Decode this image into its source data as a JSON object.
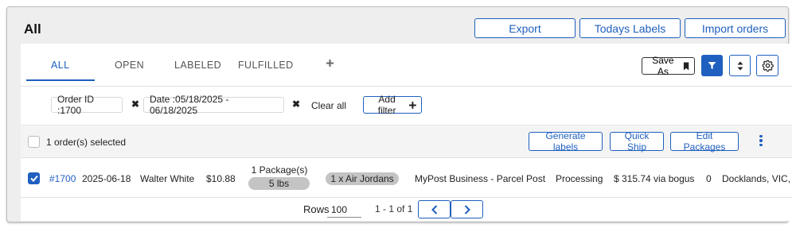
{
  "page": {
    "title": "All"
  },
  "header_buttons": {
    "export": "Export",
    "todays_labels": "Todays Labels",
    "import_orders": "Import orders"
  },
  "tabs": [
    {
      "label": "ALL",
      "active": true
    },
    {
      "label": "OPEN",
      "active": false
    },
    {
      "label": "LABELED",
      "active": false
    },
    {
      "label": "FULFILLED",
      "active": false
    }
  ],
  "toolbar": {
    "add_tab_icon": "plus-icon",
    "save_as": "Save As",
    "save_as_icon": "bookmark-icon",
    "filter_icon": "filter-icon",
    "sort_icon": "sort-icon",
    "settings_icon": "gear-icon"
  },
  "filters": {
    "chips": [
      {
        "label": "Order ID :1700"
      },
      {
        "label": "Date :05/18/2025 - 06/18/2025"
      }
    ],
    "clear_all": "Clear all",
    "add_filter": "Add filter"
  },
  "bulk": {
    "selected_text": "1 order(s) selected",
    "generate_labels": "Generate labels",
    "quick_ship": "Quick Ship",
    "edit_packages": "Edit Packages"
  },
  "orders": [
    {
      "selected": true,
      "order_id": "#1700",
      "date": "2025-06-18",
      "customer": "Walter White",
      "amount": "$10.88",
      "packages": "1 Package(s)",
      "weight": "5 lbs",
      "items": "1 x Air Jordans",
      "service": "MyPost Business - Parcel Post",
      "status": "Processing",
      "shipping": "$ 315.74 via bogus",
      "count": "0",
      "destination": "Docklands, VIC,"
    }
  ],
  "pagination": {
    "rows_label": "Rows",
    "rows_value": "100",
    "range": "1 - 1 of 1"
  },
  "colors": {
    "accent": "#1f5fbf",
    "pill": "#c4c4c4",
    "background": "#eeeeee"
  }
}
